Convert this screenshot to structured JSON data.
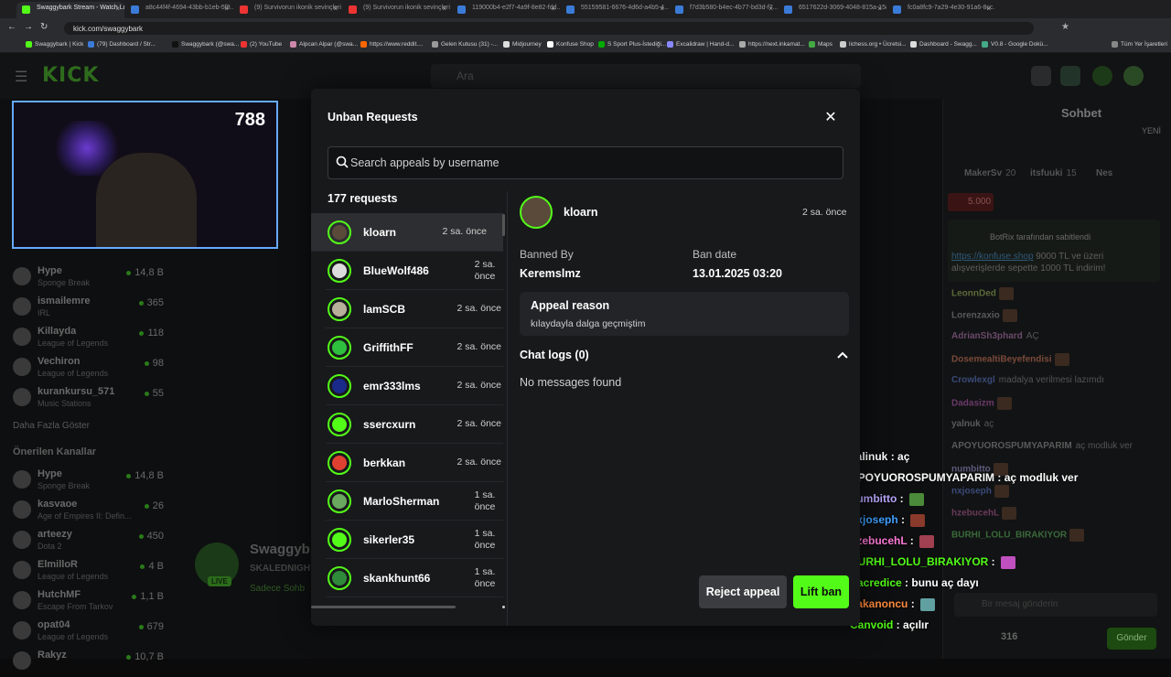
{
  "browser": {
    "tabs": [
      {
        "label": "Swaggybark Stream - Watch Live",
        "active": true
      },
      {
        "label": "a8c44f4f-4694-43bb-b1eb-5f8..."
      },
      {
        "label": "(9) Survivorun ikonik sevinçleri"
      },
      {
        "label": "(9) Survivorun ikonik sevinçleri"
      },
      {
        "label": "119000b4-e2f7-4a9f-8e82-fdd..."
      },
      {
        "label": "55159581-6676-4d6d-a4b5-4..."
      },
      {
        "label": "f7d3b580-b4ec-4b77-bd3d-f7..."
      },
      {
        "label": "6517622d-3069-4048-815a-158..."
      },
      {
        "label": "fc0a8fc9-7a29-4e30-91a6-8cc..."
      }
    ],
    "url": "kick.com/swaggybark",
    "bookmarks": [
      "Swaggybark | Kick",
      "(79) Dashboard / Str...",
      "Swaggybark (@swa...",
      "(2) YouTube",
      "Alpcan Alpar (@swa...",
      "https://www.reddit....",
      "Gelen Kutusu (31) -...",
      "Midjourney",
      "Konfuse Shop",
      "S Sport Plus-İstediği...",
      "Excalidraw | Hand-d...",
      "https://next.inkamat...",
      "Maps",
      "lichess.org • Ücretsi...",
      "Dashboard - Swagg...",
      "V0.8 - Google Dokü..."
    ],
    "bookmarks_right": "Tüm Yer İşaretleri"
  },
  "site": {
    "logo": "KICK",
    "search_placeholder": "Ara"
  },
  "sidebar": {
    "followed": [
      {
        "name": "Hype",
        "category": "Sponge Break",
        "count": "14,8 B"
      },
      {
        "name": "ismailemre",
        "category": "IRL",
        "count": "365"
      },
      {
        "name": "Killayda",
        "category": "League of Legends",
        "count": "118"
      },
      {
        "name": "Vechiron",
        "category": "League of Legends",
        "count": "98"
      },
      {
        "name": "kurankursu_571",
        "category": "Music Stations",
        "count": "55"
      }
    ],
    "show_more": "Daha Fazla Göster",
    "recommended_heading": "Önerilen Kanallar",
    "recommended": [
      {
        "name": "Hype",
        "category": "Sponge Break",
        "count": "14,8 B"
      },
      {
        "name": "kasvaoe",
        "category": "Age of Empires II: Defin...",
        "count": "26"
      },
      {
        "name": "arteezy",
        "category": "Dota 2",
        "count": "450"
      },
      {
        "name": "ElmilloR",
        "category": "League of Legends",
        "count": "4 B"
      },
      {
        "name": "HutchMF",
        "category": "Escape From Tarkov",
        "count": "1,1 B"
      },
      {
        "name": "opat04",
        "category": "League of Legends",
        "count": "679"
      },
      {
        "name": "Rakyz",
        "category": "",
        "count": "10,7 B"
      }
    ]
  },
  "video": {
    "score": "788"
  },
  "streamer": {
    "name": "Swaggyb",
    "title": "SKALEDNIGH",
    "sub": "Sadece Sohb",
    "live": "LIVE"
  },
  "chat": {
    "title": "Sohbet",
    "new_badge": "YENİ",
    "pinned_by": "BotRix tarafından sabitlendi",
    "pinned_link": "https://konfuse.shop",
    "pinned_text": " 9000 TL ve üzeri alışverişlerde sepette 1000 TL indirim!",
    "gift_amount": "5.000",
    "top_users": [
      {
        "name": "MakerSv",
        "count": "20"
      },
      {
        "name": "itsfuuki",
        "count": "15"
      },
      {
        "name": "Nes",
        "count": ""
      }
    ],
    "messages": [
      {
        "user": "LeonnDed",
        "text": ""
      },
      {
        "user": "Lorenzaxio",
        "text": ""
      },
      {
        "user": "AdrianSh3phard",
        "text": "AÇ"
      },
      {
        "user": "DosemealtiBeyefendisi",
        "text": ""
      },
      {
        "user": "Crowlexgl",
        "text": "madalya verilmesi lazımdı"
      },
      {
        "user": "Dadasizm",
        "text": ""
      },
      {
        "user": "yalnuk",
        "text": "aç"
      },
      {
        "user": "APOYUOROSPUMYAPARIM",
        "text": "aç modluk ver"
      },
      {
        "user": "numbitto",
        "text": ""
      },
      {
        "user": "nxjoseph",
        "text": ""
      },
      {
        "user": "hzebucehL",
        "text": ""
      },
      {
        "user": "BURHI_LOLU_BIRAKIYOR",
        "text": ""
      }
    ],
    "input_placeholder": "Bir mesaj gönderin",
    "viewer_count": "316",
    "send_label": "Gönder"
  },
  "overlay_chat": [
    {
      "user": "yalinuk",
      "text": "aç",
      "color": "#ffffff"
    },
    {
      "user": "APOYUOROSPUMYAPARIM",
      "text": "aç modluk ver",
      "color": "#ffffff"
    },
    {
      "user": "numbitto",
      "text": "",
      "color": "#b9a7ff"
    },
    {
      "user": "nxjoseph",
      "text": "",
      "color": "#3fa0ff"
    },
    {
      "user": "hzebucehL",
      "text": "",
      "color": "#ff7ad9"
    },
    {
      "user": "BURHI_LOLU_BIRAKIYOR",
      "text": "",
      "color": "#53fc18"
    },
    {
      "user": "Sacredice",
      "text": "bunu aç dayı",
      "color": "#53fc18"
    },
    {
      "user": "hakanoncu",
      "text": "",
      "color": "#ff8a3d"
    },
    {
      "user": "Canvoid",
      "text": "açılır",
      "color": "#53fc18"
    }
  ],
  "modal": {
    "title": "Unban Requests",
    "search_placeholder": "Search appeals by username",
    "request_count": "177 requests",
    "requests": [
      {
        "user": "kloarn",
        "time": "2 sa. önce",
        "selected": true,
        "avatar_color": "#5a4a3a"
      },
      {
        "user": "BlueWolf486",
        "time": "2 sa. önce",
        "avatar_color": "#dcdcdc"
      },
      {
        "user": "lamSCB",
        "time": "2 sa. önce",
        "avatar_color": "#b8b09a"
      },
      {
        "user": "GriffithFF",
        "time": "2 sa. önce",
        "avatar_color": "#2fbf3f"
      },
      {
        "user": "emr333lms",
        "time": "2 sa. önce",
        "avatar_color": "#1a2a8a"
      },
      {
        "user": "ssercxurn",
        "time": "2 sa. önce",
        "avatar_color": "#53fc18"
      },
      {
        "user": "berkkan",
        "time": "2 sa. önce",
        "avatar_color": "#e04030"
      },
      {
        "user": "MarloSherman",
        "time": "1 sa. önce",
        "avatar_color": "#6aa860"
      },
      {
        "user": "sikerler35",
        "time": "1 sa. önce",
        "avatar_color": "#53fc18"
      },
      {
        "user": "skankhunt66",
        "time": "1 sa. önce",
        "avatar_color": "#2f8a3a"
      }
    ],
    "detail": {
      "user": "kloarn",
      "time": "2 sa. önce",
      "banned_by_label": "Banned By",
      "banned_by": "Keremslmz",
      "ban_date_label": "Ban date",
      "ban_date": "13.01.2025 03:20",
      "appeal_reason_label": "Appeal reason",
      "appeal_reason": "kılaydayla dalga geçmiştim",
      "chat_logs_label": "Chat logs (0)",
      "no_messages": "No messages found"
    },
    "reject_label": "Reject appeal",
    "lift_label": "Lift ban"
  },
  "colors": {
    "accent": "#53fc18",
    "modal_bg": "#18191b",
    "surface": "#232427"
  }
}
